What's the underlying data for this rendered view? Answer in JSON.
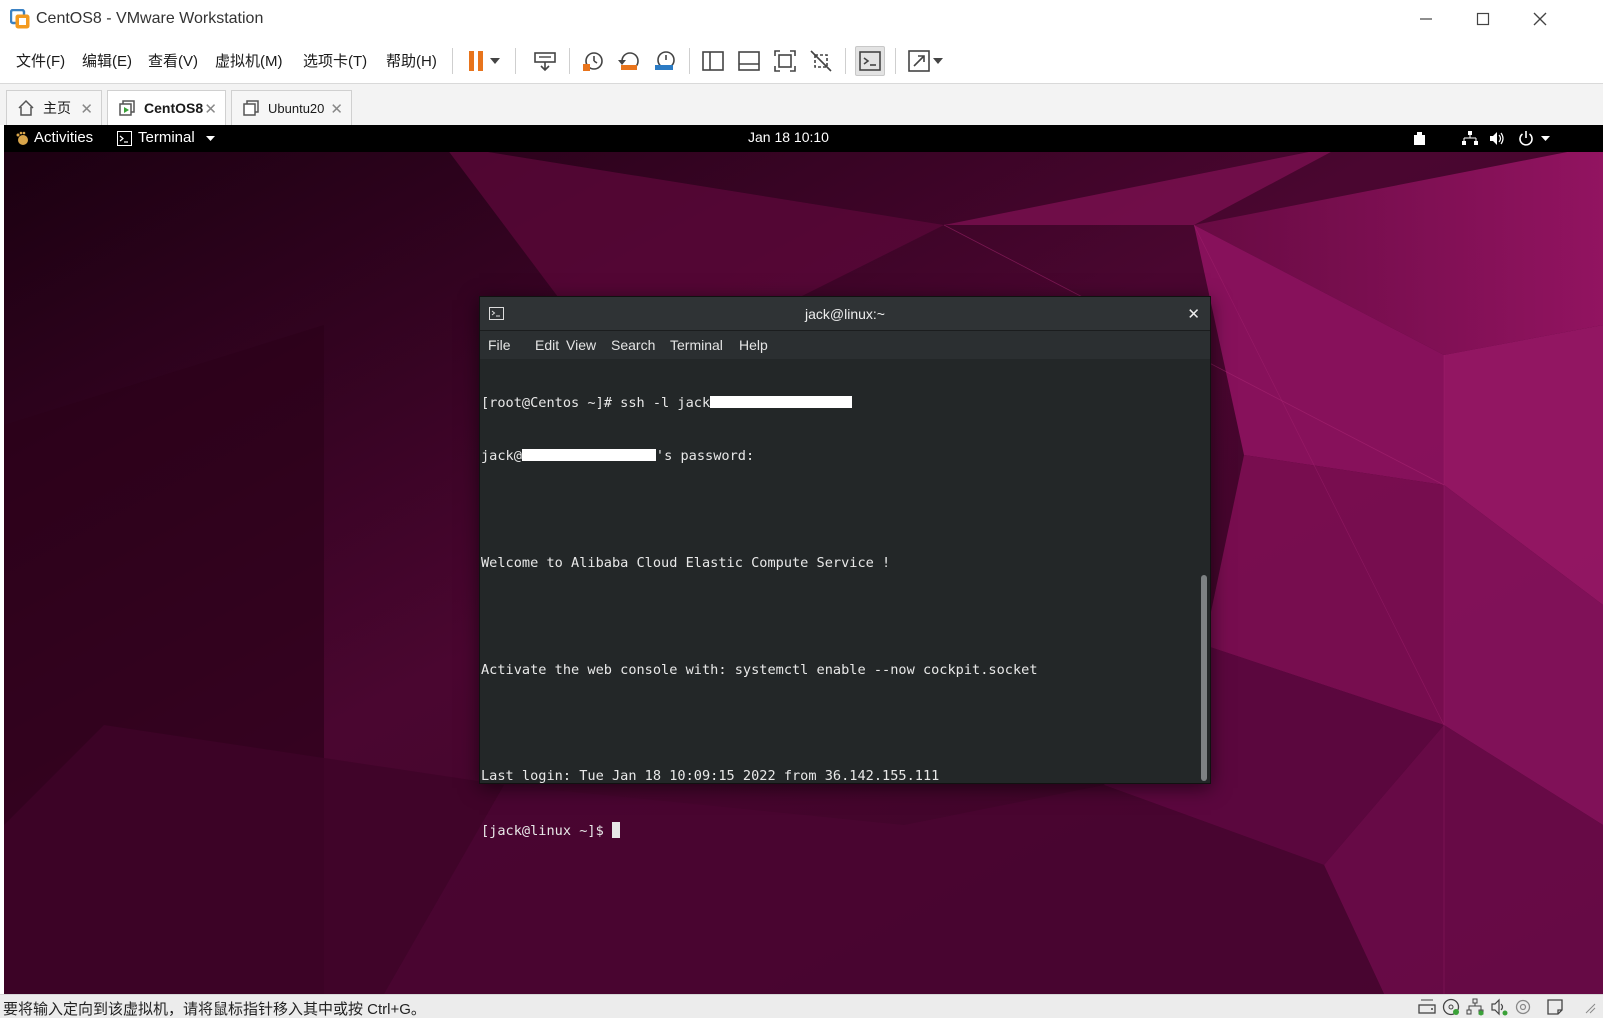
{
  "window": {
    "title": "CentOS8 - VMware Workstation"
  },
  "menubar": {
    "items": [
      "文件(F)",
      "编辑(E)",
      "查看(V)",
      "虚拟机(M)",
      "选项卡(T)",
      "帮助(H)"
    ]
  },
  "tabs": [
    {
      "label": "主页",
      "icon": "home-icon",
      "active": false
    },
    {
      "label": "CentOS8",
      "icon": "vm-running-icon",
      "active": true
    },
    {
      "label": "Ubuntu20",
      "icon": "vm-icon",
      "active": false
    }
  ],
  "gnome": {
    "activities": "Activities",
    "app_menu": "Terminal",
    "clock": "Jan 18  10:10"
  },
  "terminal": {
    "title": "jack@linux:~",
    "menu": [
      "File",
      "Edit",
      "View",
      "Search",
      "Terminal",
      "Help"
    ],
    "lines": {
      "l1": "[root@Centos ~]# ssh -l jack",
      "l2a": "jack@",
      "l2b": "'s password:",
      "l3": "Welcome to Alibaba Cloud Elastic Compute Service !",
      "l4": "Activate the web console with: systemctl enable --now cockpit.socket",
      "l5": "Last login: Tue Jan 18 10:09:15 2022 from 36.142.155.111",
      "l6": "[jack@linux ~]$ "
    }
  },
  "statusbar": {
    "text": "要将输入定向到该虚拟机，请将鼠标指针移入其中或按 Ctrl+G。"
  },
  "colors": {
    "accent_pause": "#e8741c",
    "wallpaper": "#8a0f5a",
    "terminal_bg": "#232728"
  }
}
